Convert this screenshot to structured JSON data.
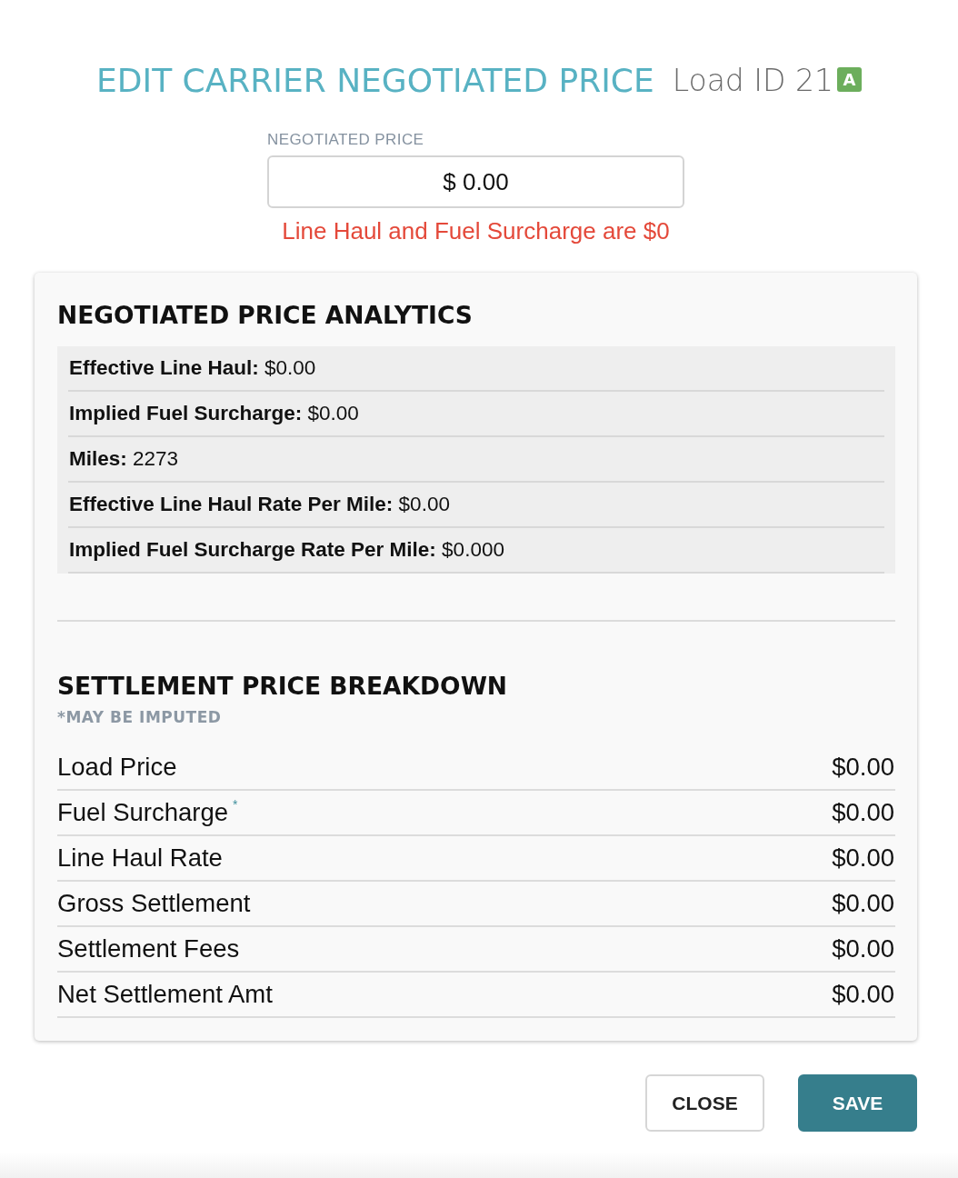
{
  "header": {
    "title": "EDIT CARRIER NEGOTIATED PRICE",
    "load_id": "Load ID 21",
    "badge": "A"
  },
  "price_field": {
    "label": "NEGOTIATED PRICE",
    "value": "$ 0.00",
    "error": "Line Haul and Fuel Surcharge are $0"
  },
  "analytics": {
    "title": "NEGOTIATED PRICE ANALYTICS",
    "items": [
      {
        "label": "Effective Line Haul:",
        "value": "$0.00"
      },
      {
        "label": "Implied Fuel Surcharge:",
        "value": "$0.00"
      },
      {
        "label": "Miles:",
        "value": "2273"
      },
      {
        "label": "Effective Line Haul Rate Per Mile:",
        "value": "$0.00"
      },
      {
        "label": "Implied Fuel Surcharge Rate Per Mile:",
        "value": "$0.000"
      }
    ]
  },
  "breakdown": {
    "title": "SETTLEMENT PRICE BREAKDOWN",
    "note": "*MAY BE IMPUTED",
    "rows": [
      {
        "label": "Load Price",
        "value": "$0.00"
      },
      {
        "label": "Fuel Surcharge",
        "mark": "*",
        "value": "$0.00"
      },
      {
        "label": "Line Haul Rate",
        "value": "$0.00"
      },
      {
        "label": "Gross Settlement",
        "value": "$0.00"
      },
      {
        "label": "Settlement Fees",
        "value": "$0.00"
      },
      {
        "label": "Net Settlement Amt",
        "value": "$0.00"
      }
    ]
  },
  "buttons": [
    {
      "label": "CLOSE",
      "kind": "secondary"
    },
    {
      "label": "SAVE",
      "kind": "primary"
    }
  ]
}
